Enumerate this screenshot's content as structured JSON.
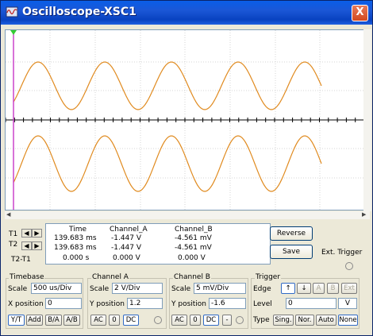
{
  "window": {
    "title": "Oscilloscope-XSC1",
    "close_label": "X"
  },
  "readout": {
    "cursor_labels": {
      "t1": "T1",
      "t2": "T2",
      "t2t1": "T2-T1"
    },
    "headers": {
      "time": "Time",
      "channel_a": "Channel_A",
      "channel_b": "Channel_B"
    },
    "rows": [
      {
        "time": "139.683 ms",
        "a": "-1.447 V",
        "b": "-4.561 mV"
      },
      {
        "time": "139.683 ms",
        "a": "-1.447 V",
        "b": "-4.561 mV"
      },
      {
        "time": "0.000 s",
        "a": "0.000 V",
        "b": "0.000 V"
      }
    ]
  },
  "buttons": {
    "reverse": "Reverse",
    "save": "Save",
    "ext_trigger": "Ext. Trigger"
  },
  "timebase": {
    "title": "Timebase",
    "scale_label": "Scale",
    "scale_value": "500 us/Div",
    "xpos_label": "X position",
    "xpos_value": "0",
    "modes": [
      "Y/T",
      "Add",
      "B/A",
      "A/B"
    ]
  },
  "channel_a": {
    "title": "Channel A",
    "scale_label": "Scale",
    "scale_value": "2  V/Div",
    "ypos_label": "Y position",
    "ypos_value": "1.2",
    "coupling": [
      "AC",
      "0",
      "DC"
    ]
  },
  "channel_b": {
    "title": "Channel B",
    "scale_label": "Scale",
    "scale_value": "5 mV/Div",
    "ypos_label": "Y position",
    "ypos_value": "-1.6",
    "coupling": [
      "AC",
      "0",
      "DC",
      "-"
    ]
  },
  "trigger": {
    "title": "Trigger",
    "edge_label": "Edge",
    "edge_rise": "↑",
    "edge_fall": "↓",
    "sources": [
      "A",
      "B",
      "Ext"
    ],
    "level_label": "Level",
    "level_value": "0",
    "level_unit": "V",
    "type_label": "Type",
    "types": [
      "Sing.",
      "Nor.",
      "Auto",
      "None"
    ]
  },
  "colors": {
    "trace": "#e08a1e",
    "cursor": "#cc44cc",
    "grid": "#c8c8c8"
  }
}
